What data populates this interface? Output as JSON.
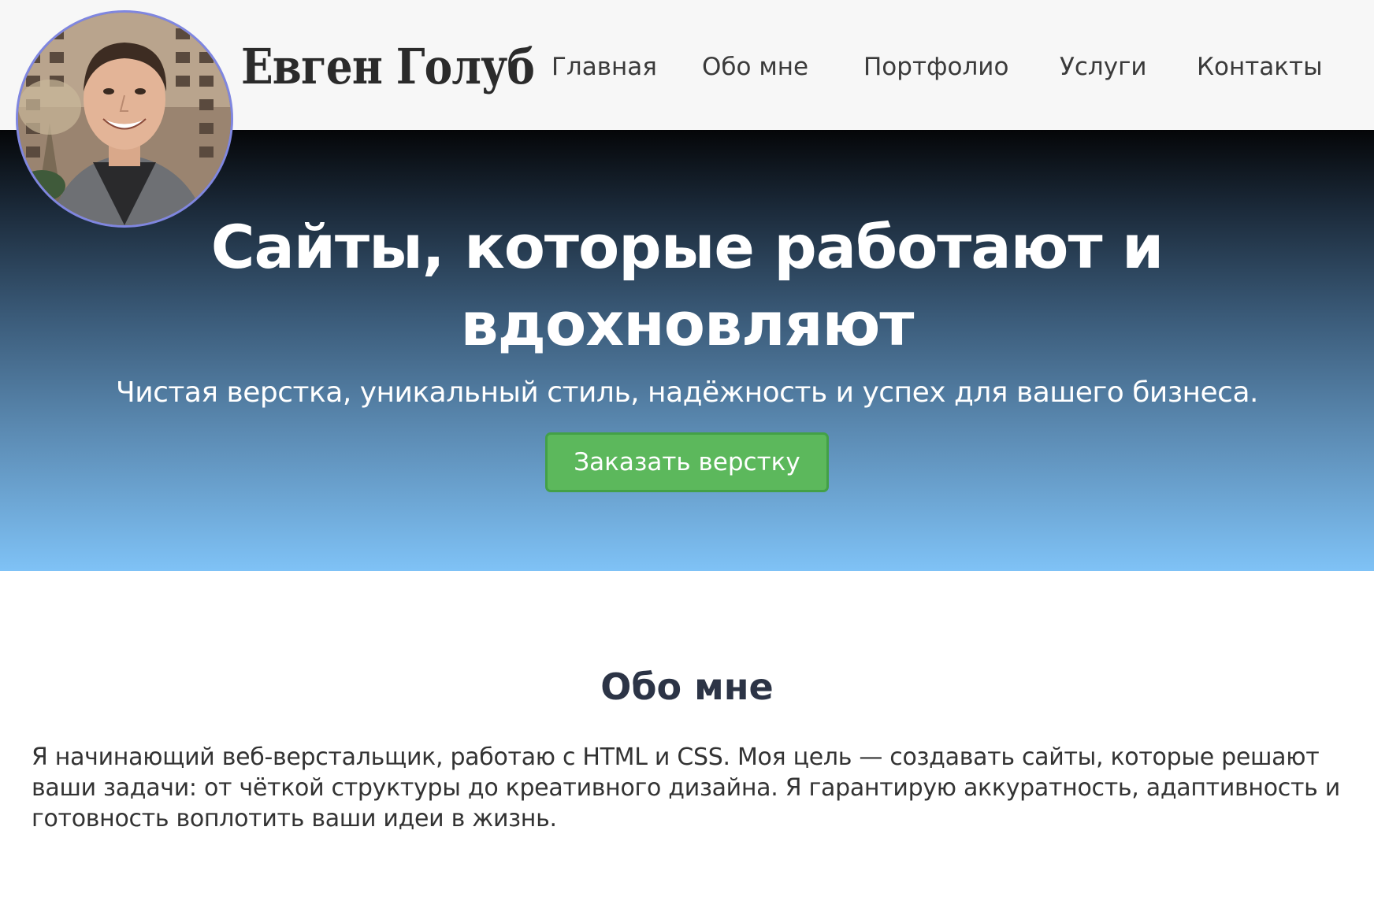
{
  "header": {
    "site_name": "Евген Голуб",
    "avatar_alt": "",
    "nav": [
      {
        "label": "Главная"
      },
      {
        "label": "Обо мне"
      },
      {
        "label": "Портфолио"
      },
      {
        "label": "Услуги"
      },
      {
        "label": "Контакты"
      }
    ]
  },
  "hero": {
    "title": "Сайты, которые работают и вдохновляют",
    "subtitle": "Чистая верстка, уникальный стиль, надёжность и успех для вашего бизнеса.",
    "cta_label": "Заказать верстку"
  },
  "about": {
    "title": "Обо мне",
    "text": "Я начинающий веб-верстальщик, работаю с HTML и CSS. Моя цель — создавать сайты, которые решают ваши задачи: от чёткой структуры до креативного дизайна. Я гарантирую аккуратность, адаптивность и готовность воплотить ваши идеи в жизнь."
  },
  "colors": {
    "header_bg": "#f7f7f7",
    "hero_gradient_top": "#050608",
    "hero_gradient_bottom": "#7fc2f6",
    "cta_bg": "#5cb85c",
    "about_title": "#2c3446",
    "avatar_border": "#7f86e0"
  }
}
